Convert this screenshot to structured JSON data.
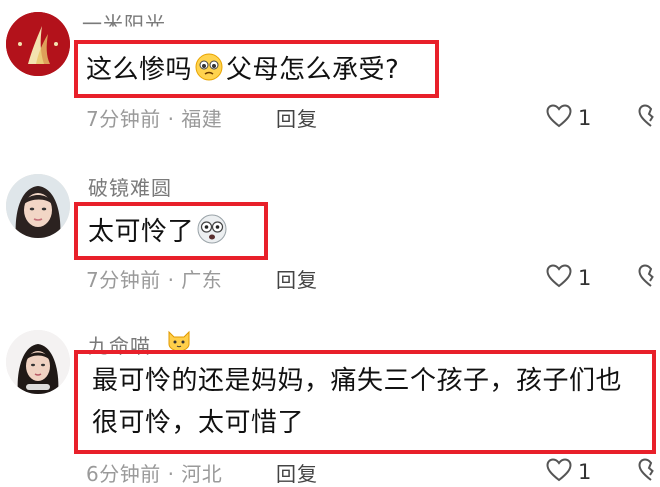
{
  "comments": [
    {
      "username": "一米阳光",
      "text_before": "这么惨吗",
      "emoji": "pleading-face-icon",
      "text_after": "父母怎么承受?",
      "time": "7分钟前 · 福建",
      "reply_label": "回复",
      "likes": "1"
    },
    {
      "username": "破镜难圆",
      "text_before": "太可怜了",
      "emoji": "shocked-face-icon",
      "text_after": "",
      "time": "7分钟前 · 广东",
      "reply_label": "回复",
      "likes": "1"
    },
    {
      "username": "九命喵",
      "username_emoji": "cat-face-icon",
      "text_line1": "最可怜的还是妈妈，痛失三个孩子，孩子们也",
      "text_line2": "很可怜，太可惜了",
      "time": "6分钟前 · 河北",
      "reply_label": "回复",
      "likes": "1"
    }
  ],
  "colors": {
    "highlight_border": "#e8202a",
    "meta_text": "#9a9a9a",
    "username_text": "#7a7a7a",
    "avatar1_bg": "#b3121b"
  }
}
